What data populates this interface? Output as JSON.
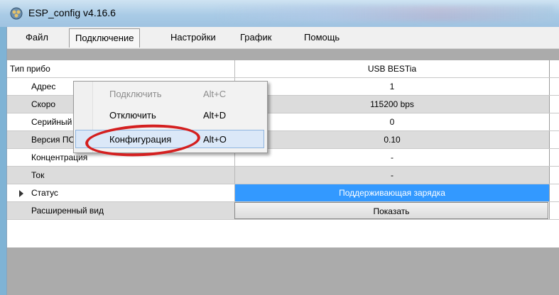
{
  "window": {
    "title": "ESP_config v4.16.6"
  },
  "menubar": {
    "items": [
      {
        "label": "Файл"
      },
      {
        "label": "Подключение"
      },
      {
        "label": "Настройки"
      },
      {
        "label": "График"
      },
      {
        "label": "Помощь"
      }
    ]
  },
  "dropdown": {
    "items": [
      {
        "label": "Подключить",
        "shortcut": "Alt+C",
        "state": "disabled"
      },
      {
        "label": "Отключить",
        "shortcut": "Alt+D",
        "state": "normal"
      },
      {
        "label": "Конфигурация",
        "shortcut": "Alt+O",
        "state": "hover"
      }
    ]
  },
  "grid": {
    "header": {
      "name": "Тип прибо",
      "value": "USB BESTia"
    },
    "rows": [
      {
        "name": "Адрес",
        "value": "1"
      },
      {
        "name": "Скоро",
        "value": "115200 bps"
      },
      {
        "name": "Серийный номер",
        "value": "0"
      },
      {
        "name": "Версия ПО",
        "value": "0.10"
      },
      {
        "name": "Концентрация",
        "value": "-"
      },
      {
        "name": "Ток",
        "value": "-"
      },
      {
        "name": "Статус",
        "value": "Поддерживающая зарядка"
      },
      {
        "name": "Расширенный вид",
        "value": "Показать"
      }
    ]
  },
  "colors": {
    "selection": "#3399ff",
    "annotation_circle": "#d41f1f"
  },
  "icons": {
    "app_icon": "app-icon"
  }
}
